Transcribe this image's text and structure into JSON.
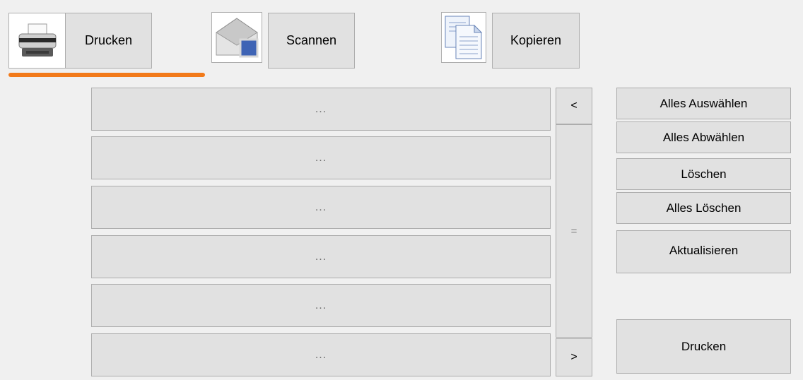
{
  "tabs": [
    {
      "label": "Drucken",
      "icon": "printer-icon"
    },
    {
      "label": "Scannen",
      "icon": "envelope-scan-icon"
    },
    {
      "label": "Kopieren",
      "icon": "documents-copy-icon"
    }
  ],
  "active_tab": "Drucken",
  "accent_color": "#f27a1a",
  "list": {
    "rows": [
      "...",
      "...",
      "...",
      "...",
      "...",
      "..."
    ],
    "prev_label": "<",
    "next_label": ">",
    "scroll_handle": "="
  },
  "actions": {
    "select_all": "Alles Auswählen",
    "deselect_all": "Alles Abwählen",
    "delete": "Löschen",
    "delete_all": "Alles Löschen",
    "refresh": "Aktualisieren",
    "print": "Drucken"
  }
}
